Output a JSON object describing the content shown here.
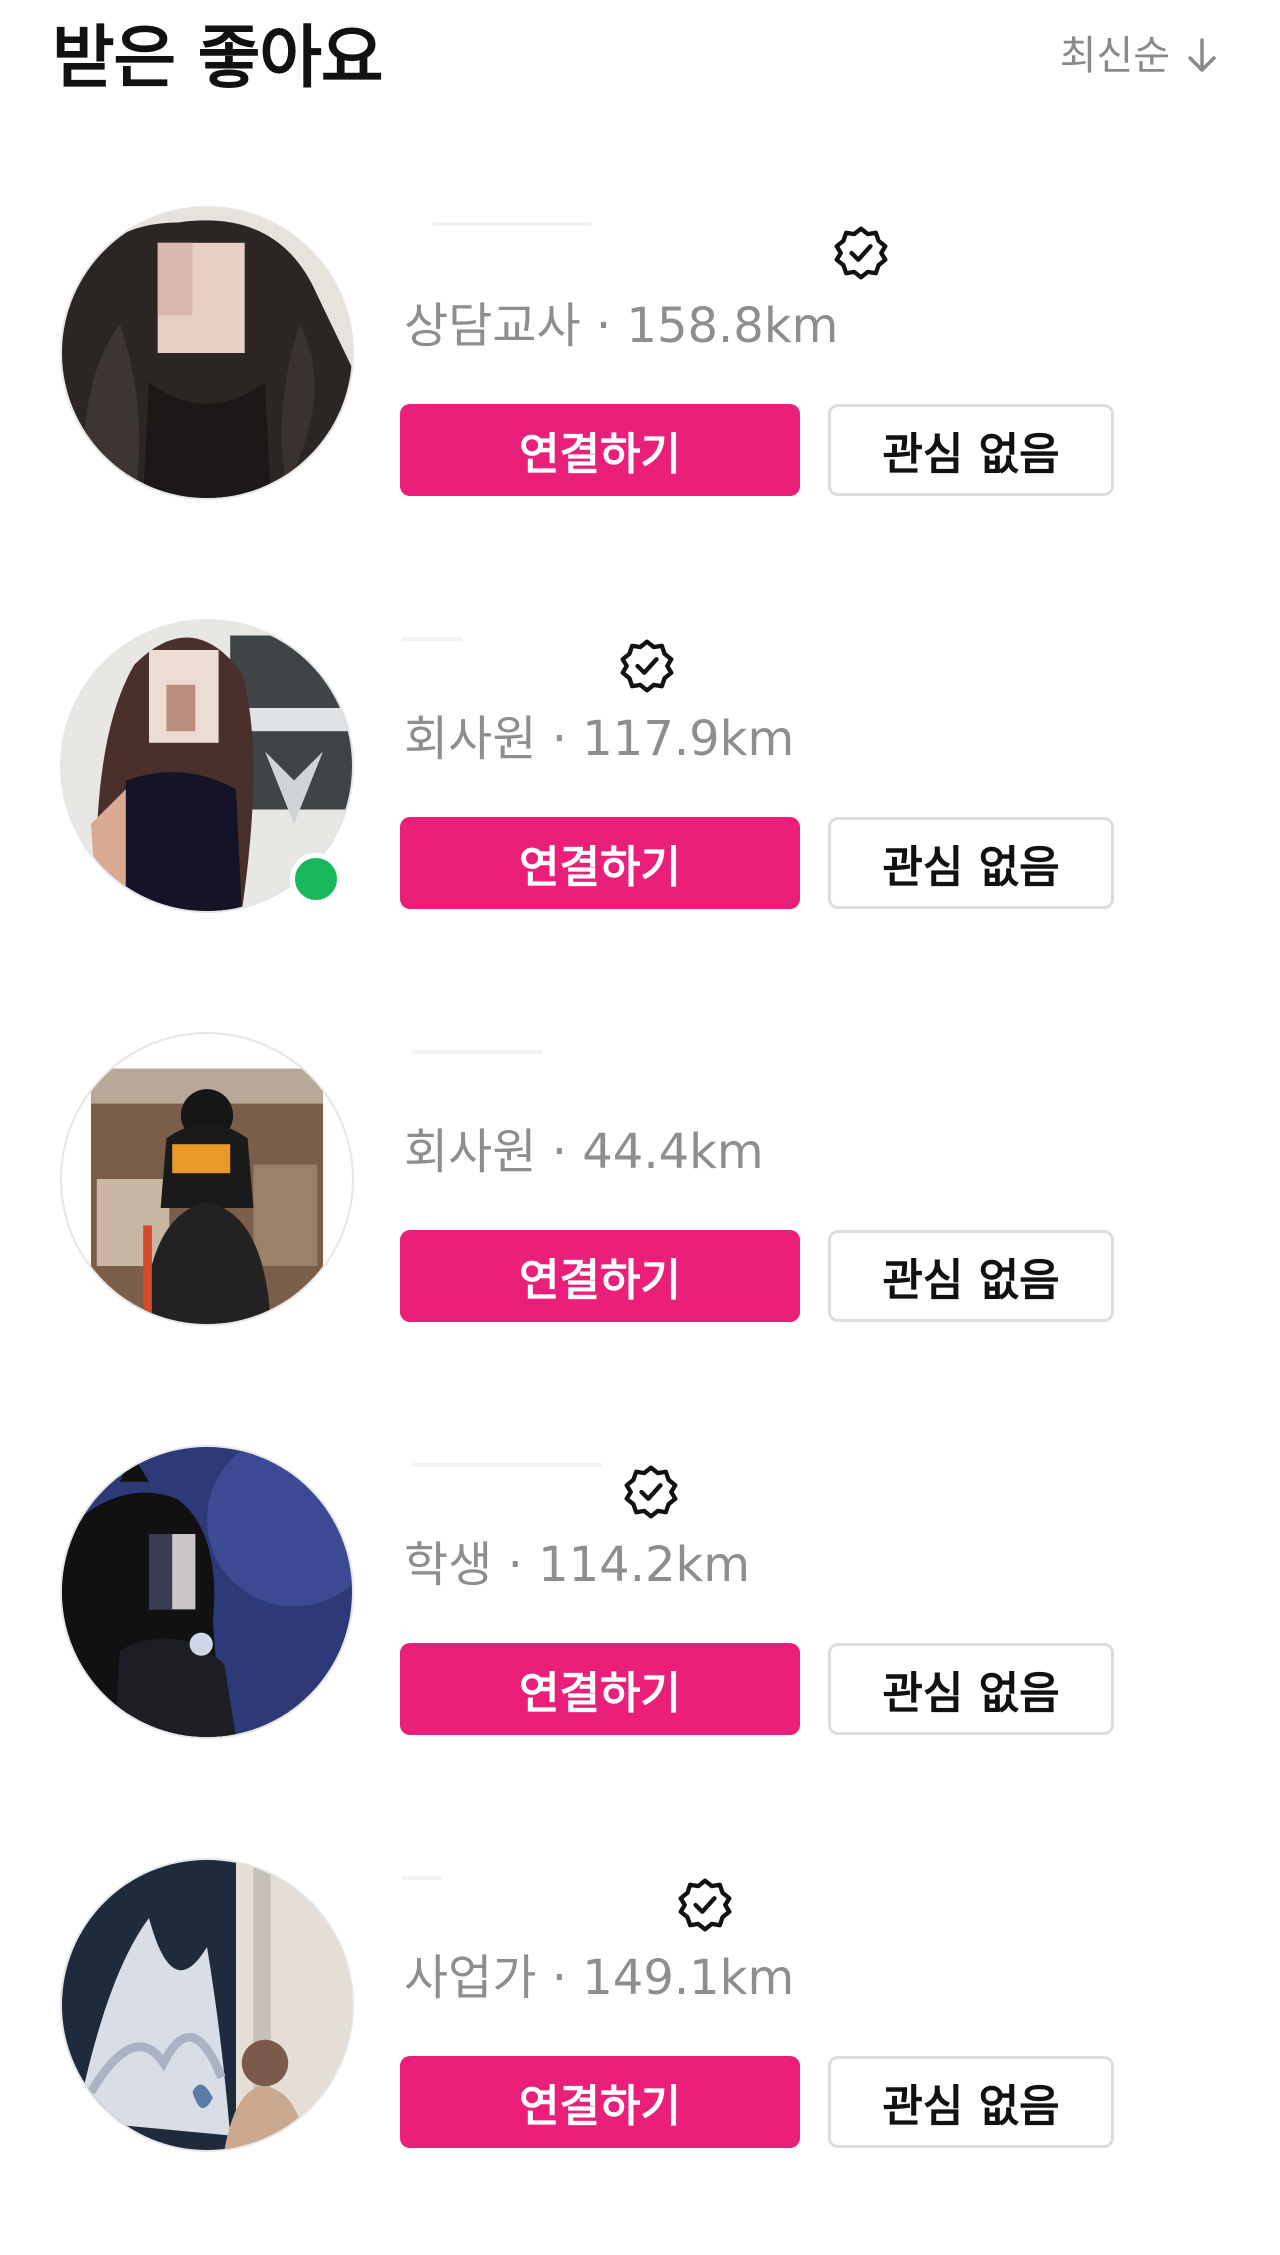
{
  "header": {
    "title": "받은 좋아요",
    "sort_label": "최신순",
    "sort_icon": "arrow-down-icon"
  },
  "colors": {
    "connect_button": "#ea1f79",
    "online_indicator": "#17b85a",
    "subtitle_text": "#8e8e8e"
  },
  "likes": [
    {
      "occupation": "상담교사",
      "distance": "158.8km",
      "subtitle": "상담교사 · 158.8km",
      "verified": true,
      "online": false,
      "connect_label": "연결하기",
      "pass_label": "관심 없음"
    },
    {
      "occupation": "회사원",
      "distance": "117.9km",
      "subtitle": "회사원 · 117.9km",
      "verified": true,
      "online": true,
      "connect_label": "연결하기",
      "pass_label": "관심 없음"
    },
    {
      "occupation": "회사원",
      "distance": "44.4km",
      "subtitle": "회사원 · 44.4km",
      "verified": false,
      "online": false,
      "connect_label": "연결하기",
      "pass_label": "관심 없음"
    },
    {
      "occupation": "학생",
      "distance": "114.2km",
      "subtitle": "학생 · 114.2km",
      "verified": true,
      "online": false,
      "connect_label": "연결하기",
      "pass_label": "관심 없음"
    },
    {
      "occupation": "사업가",
      "distance": "149.1km",
      "subtitle": "사업가 · 149.1km",
      "verified": true,
      "online": false,
      "connect_label": "연결하기",
      "pass_label": "관심 없음"
    }
  ]
}
